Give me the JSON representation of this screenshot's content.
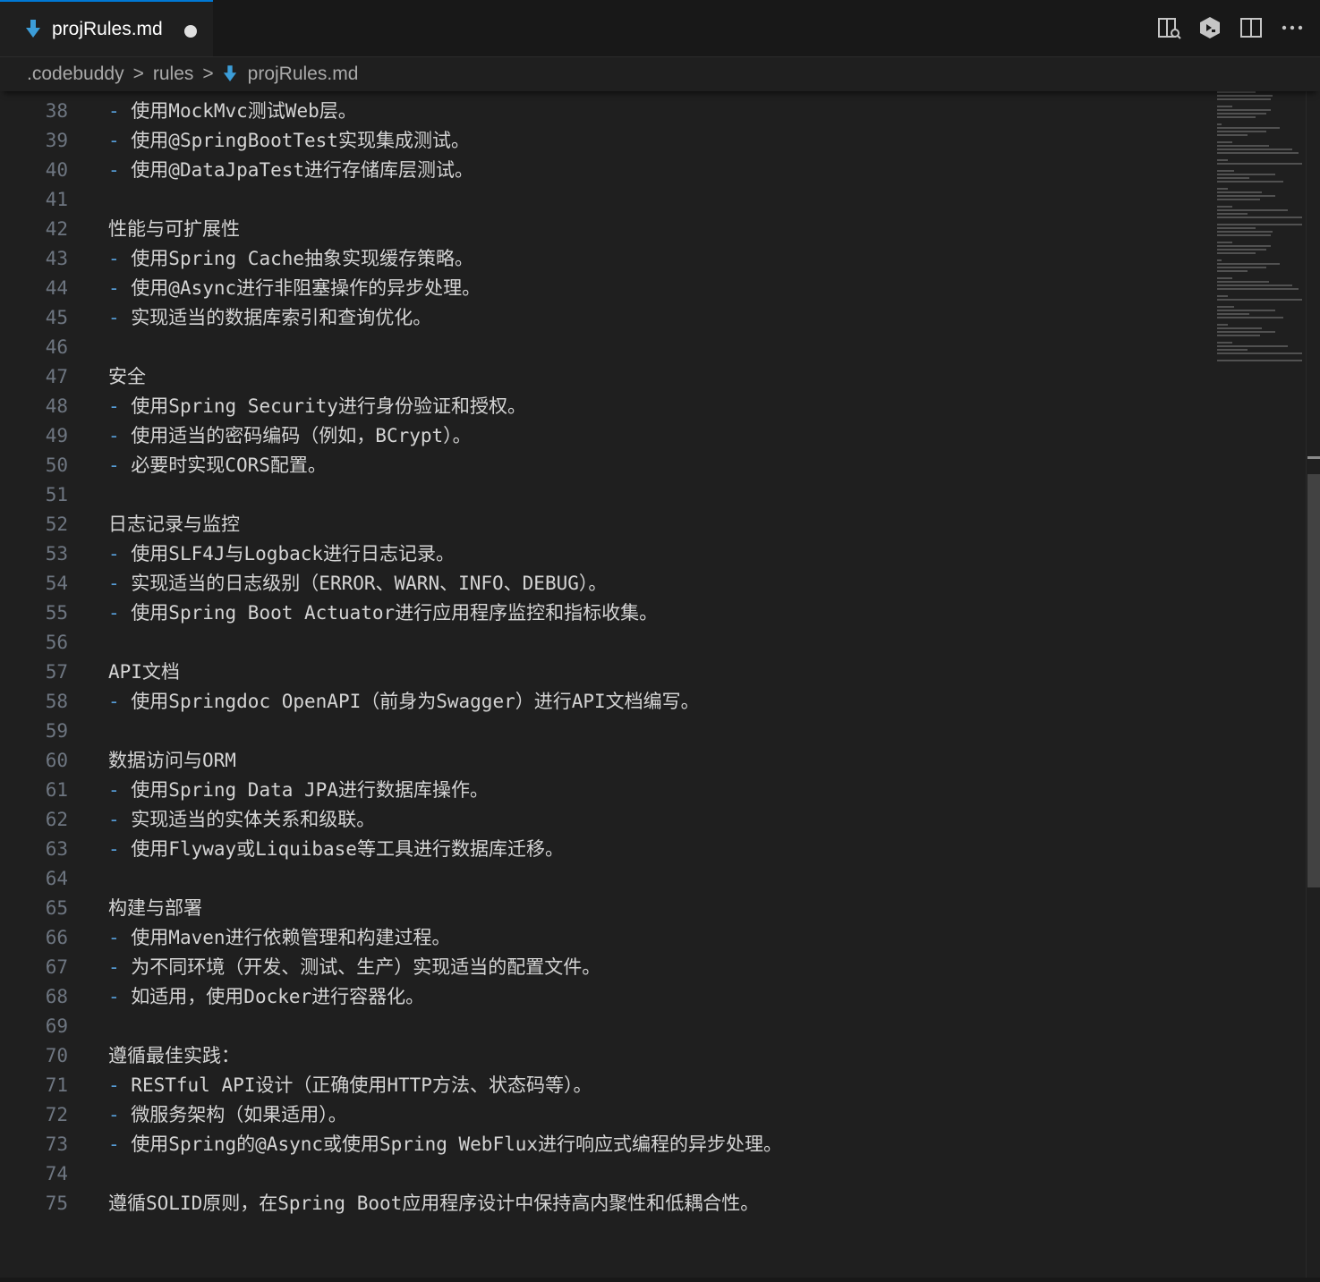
{
  "tab": {
    "label": "projRules.md",
    "modified": true
  },
  "actions": [
    {
      "name": "open-preview-to-side-icon"
    },
    {
      "name": "codebuddy-icon"
    },
    {
      "name": "split-editor-icon"
    },
    {
      "name": "more-actions-icon"
    }
  ],
  "breadcrumb": {
    "parts": [
      ".codebuddy",
      "rules",
      "projRules.md"
    ],
    "separator": ">"
  },
  "editor": {
    "lines": [
      {
        "num": "38",
        "text": "- 使用MockMvc测试Web层。"
      },
      {
        "num": "39",
        "text": "- 使用@SpringBootTest实现集成测试。"
      },
      {
        "num": "40",
        "text": "- 使用@DataJpaTest进行存储库层测试。"
      },
      {
        "num": "41",
        "text": ""
      },
      {
        "num": "42",
        "text": "性能与可扩展性"
      },
      {
        "num": "43",
        "text": "- 使用Spring Cache抽象实现缓存策略。"
      },
      {
        "num": "44",
        "text": "- 使用@Async进行非阻塞操作的异步处理。"
      },
      {
        "num": "45",
        "text": "- 实现适当的数据库索引和查询优化。"
      },
      {
        "num": "46",
        "text": ""
      },
      {
        "num": "47",
        "text": "安全"
      },
      {
        "num": "48",
        "text": "- 使用Spring Security进行身份验证和授权。"
      },
      {
        "num": "49",
        "text": "- 使用适当的密码编码（例如，BCrypt）。"
      },
      {
        "num": "50",
        "text": "- 必要时实现CORS配置。"
      },
      {
        "num": "51",
        "text": ""
      },
      {
        "num": "52",
        "text": "日志记录与监控"
      },
      {
        "num": "53",
        "text": "- 使用SLF4J与Logback进行日志记录。"
      },
      {
        "num": "54",
        "text": "- 实现适当的日志级别（ERROR、WARN、INFO、DEBUG）。"
      },
      {
        "num": "55",
        "text": "- 使用Spring Boot Actuator进行应用程序监控和指标收集。"
      },
      {
        "num": "56",
        "text": ""
      },
      {
        "num": "57",
        "text": "API文档"
      },
      {
        "num": "58",
        "text": "- 使用Springdoc OpenAPI（前身为Swagger）进行API文档编写。"
      },
      {
        "num": "59",
        "text": ""
      },
      {
        "num": "60",
        "text": "数据访问与ORM"
      },
      {
        "num": "61",
        "text": "- 使用Spring Data JPA进行数据库操作。"
      },
      {
        "num": "62",
        "text": "- 实现适当的实体关系和级联。"
      },
      {
        "num": "63",
        "text": "- 使用Flyway或Liquibase等工具进行数据库迁移。"
      },
      {
        "num": "64",
        "text": ""
      },
      {
        "num": "65",
        "text": "构建与部署"
      },
      {
        "num": "66",
        "text": "- 使用Maven进行依赖管理和构建过程。"
      },
      {
        "num": "67",
        "text": "- 为不同环境（开发、测试、生产）实现适当的配置文件。"
      },
      {
        "num": "68",
        "text": "- 如适用，使用Docker进行容器化。"
      },
      {
        "num": "69",
        "text": ""
      },
      {
        "num": "70",
        "text": "遵循最佳实践："
      },
      {
        "num": "71",
        "text": "- RESTful API设计（正确使用HTTP方法、状态码等）。"
      },
      {
        "num": "72",
        "text": "- 微服务架构（如果适用）。"
      },
      {
        "num": "73",
        "text": "- 使用Spring的@Async或使用Spring WebFlux进行响应式编程的异步处理。"
      },
      {
        "num": "74",
        "text": ""
      },
      {
        "num": "75",
        "text": "遵循SOLID原则，在Spring Boot应用程序设计中保持高内聚性和低耦合性。"
      }
    ]
  },
  "colors": {
    "background": "#1f1f1f",
    "tabbar": "#181818",
    "accent": "#0078d4",
    "line_number": "#6e7681",
    "list_marker": "#569cd6",
    "text": "#d4d4d4"
  }
}
